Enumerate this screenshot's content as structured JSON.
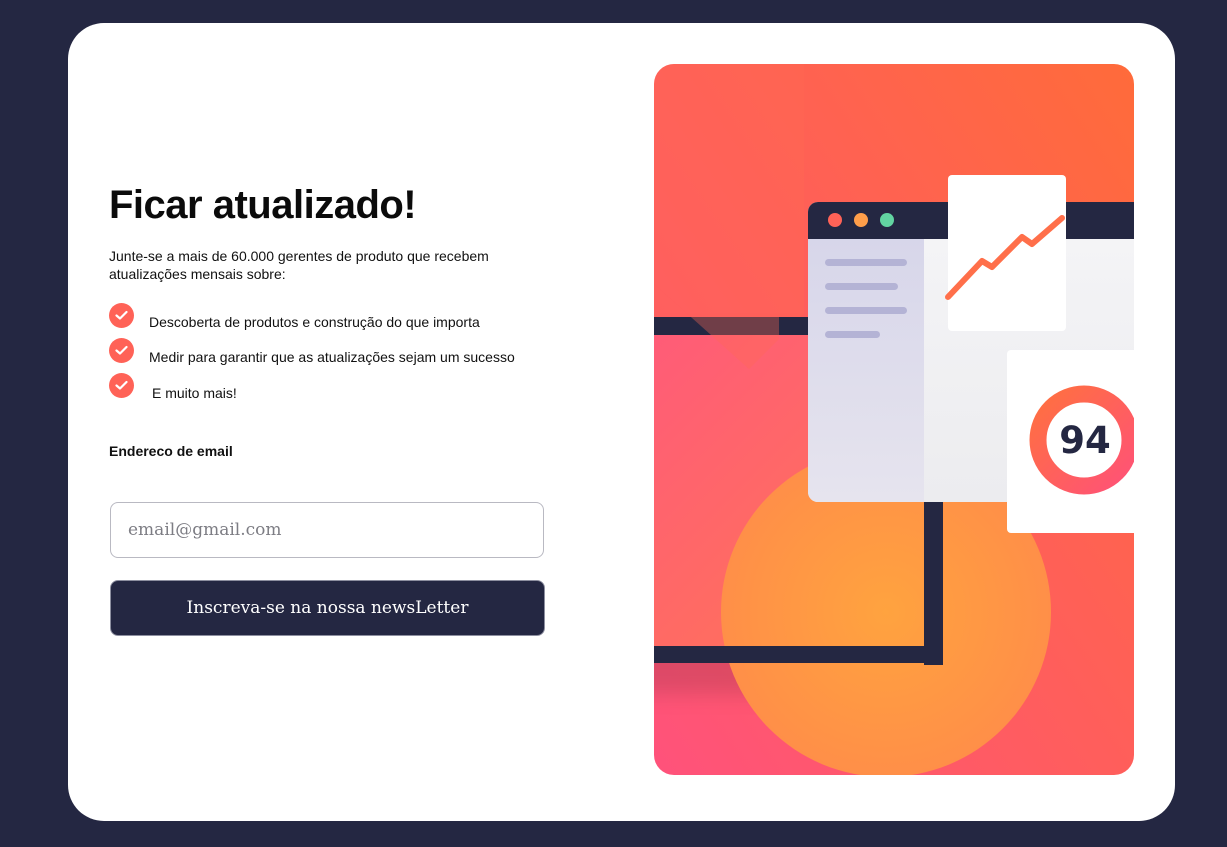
{
  "signup": {
    "title": "Ficar atualizado!",
    "intro": "Junte-se a mais de 60.000 gerentes de produto que recebem atualizações mensais sobre:",
    "benefits": [
      "Descoberta de produtos e construção do que importa",
      "Medir para garantir que as atualizações sejam um sucesso",
      "E muito mais!"
    ],
    "email_label": "Endereco de email",
    "email_placeholder": "email@gmail.com",
    "email_value": "",
    "submit_label": "Inscreva-se na nossa newsLetter"
  },
  "illustration": {
    "score": "94",
    "colors": {
      "background": "#242742",
      "accent": "#ff6257",
      "gradient_top": "#ff6b3a",
      "gradient_bottom": "#ff527b",
      "dot_red": "#ff6257",
      "dot_orange": "#ff9e4a",
      "dot_green": "#62d4a1"
    }
  }
}
